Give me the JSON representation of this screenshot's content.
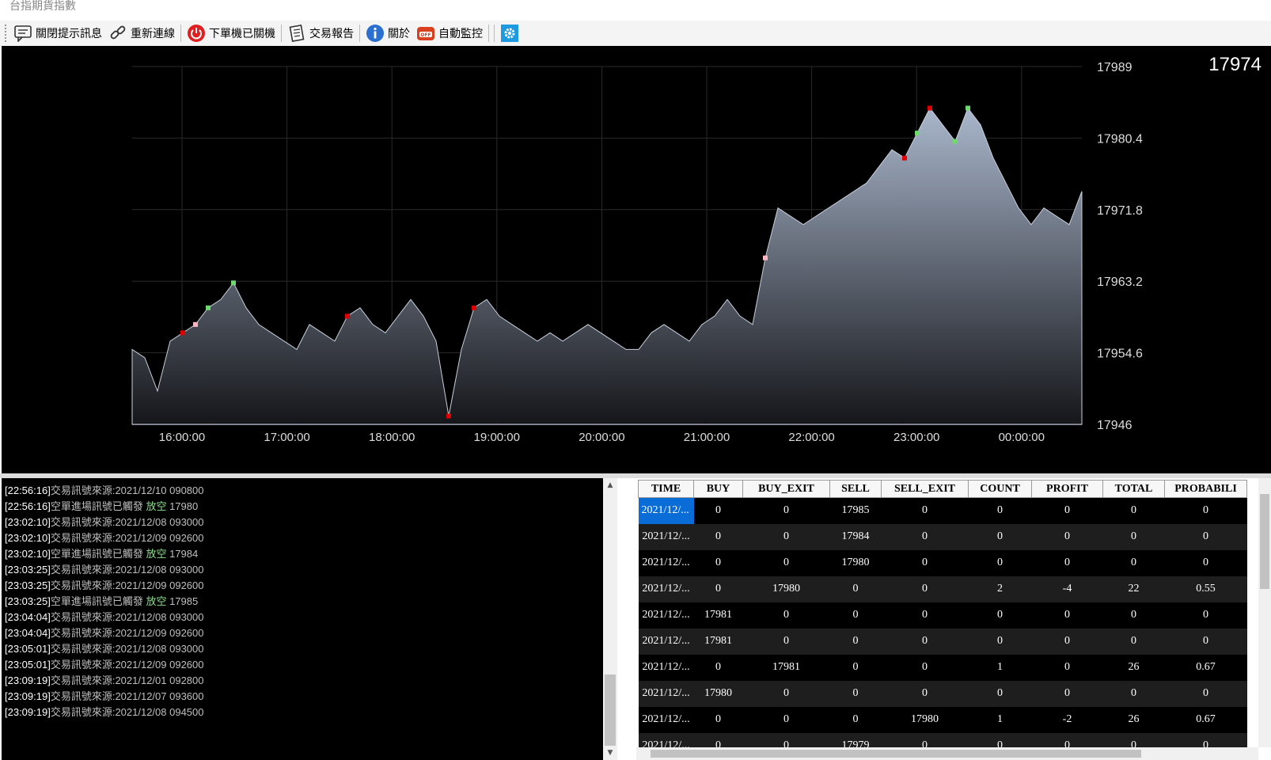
{
  "window": {
    "title": "台指期貨指數"
  },
  "toolbar": {
    "items": [
      {
        "label": "關閉提示訊息",
        "icon": "message-icon"
      },
      {
        "label": "重新連線",
        "icon": "link-icon"
      },
      {
        "label": "下單機已關機",
        "icon": "power-icon"
      },
      {
        "label": "交易報告",
        "icon": "report-icon"
      },
      {
        "label": "關於",
        "icon": "info-icon"
      },
      {
        "label": "自動監控",
        "icon": "monitor-off-icon"
      }
    ]
  },
  "current_price": "17974",
  "chart_data": {
    "type": "area",
    "x_labels": [
      "16:00:00",
      "17:00:00",
      "18:00:00",
      "19:00:00",
      "20:00:00",
      "21:00:00",
      "22:00:00",
      "23:00:00",
      "00:00:00"
    ],
    "y_labels": [
      "17989",
      "17980.4",
      "17971.8",
      "17963.2",
      "17954.6",
      "17946"
    ],
    "ylim": [
      17946,
      17989
    ],
    "series": [
      {
        "values": [
          17955,
          17954,
          17950,
          17956,
          17957,
          17958,
          17960,
          17961,
          17963,
          17960,
          17958,
          17957,
          17956,
          17955,
          17958,
          17957,
          17956,
          17959,
          17960,
          17958,
          17957,
          17959,
          17961,
          17959,
          17956,
          17947,
          17955,
          17960,
          17961,
          17959,
          17958,
          17957,
          17956,
          17957,
          17956,
          17957,
          17958,
          17957,
          17956,
          17955,
          17955,
          17957,
          17958,
          17957,
          17956,
          17958,
          17959,
          17961,
          17959,
          17958,
          17966,
          17972,
          17971,
          17970,
          17971,
          17972,
          17973,
          17974,
          17975,
          17977,
          17979,
          17978,
          17981,
          17984,
          17982,
          17980,
          17984,
          17982,
          17978,
          17975,
          17972,
          17970,
          17972,
          17971,
          17970,
          17974
        ]
      }
    ],
    "markers": {
      "buy_color": "#e00000",
      "sell_color": "#6fd86f",
      "exit_color": "#ffb6c1"
    }
  },
  "log": {
    "lines": [
      {
        "time": "[22:56:16]",
        "text": "交易訊號來源:2021/12/10 090800",
        "action": "",
        "value": ""
      },
      {
        "time": "[22:56:16]",
        "text": "空單進場訊號已觸發 ",
        "action": "放空",
        "value": " 17980"
      },
      {
        "time": "[23:02:10]",
        "text": "交易訊號來源:2021/12/08 093000",
        "action": "",
        "value": ""
      },
      {
        "time": "[23:02:10]",
        "text": "交易訊號來源:2021/12/09 092600",
        "action": "",
        "value": ""
      },
      {
        "time": "[23:02:10]",
        "text": "空單進場訊號已觸發 ",
        "action": "放空",
        "value": " 17984"
      },
      {
        "time": "[23:03:25]",
        "text": "交易訊號來源:2021/12/08 093000",
        "action": "",
        "value": ""
      },
      {
        "time": "[23:03:25]",
        "text": "交易訊號來源:2021/12/09 092600",
        "action": "",
        "value": ""
      },
      {
        "time": "[23:03:25]",
        "text": "空單進場訊號已觸發 ",
        "action": "放空",
        "value": " 17985"
      },
      {
        "time": "[23:04:04]",
        "text": "交易訊號來源:2021/12/08 093000",
        "action": "",
        "value": ""
      },
      {
        "time": "[23:04:04]",
        "text": "交易訊號來源:2021/12/09 092600",
        "action": "",
        "value": ""
      },
      {
        "time": "[23:05:01]",
        "text": "交易訊號來源:2021/12/08 093000",
        "action": "",
        "value": ""
      },
      {
        "time": "[23:05:01]",
        "text": "交易訊號來源:2021/12/09 092600",
        "action": "",
        "value": ""
      },
      {
        "time": "[23:09:19]",
        "text": "交易訊號來源:2021/12/01 092800",
        "action": "",
        "value": ""
      },
      {
        "time": "[23:09:19]",
        "text": "交易訊號來源:2021/12/07 093600",
        "action": "",
        "value": ""
      },
      {
        "time": "[23:09:19]",
        "text": "交易訊號來源:2021/12/08 094500",
        "action": "",
        "value": ""
      }
    ]
  },
  "grid": {
    "columns": [
      "TIME",
      "BUY",
      "BUY_EXIT",
      "SELL",
      "SELL_EXIT",
      "COUNT",
      "PROFIT",
      "TOTAL",
      "PROBABILI"
    ],
    "rows": [
      [
        "2021/12/...",
        "0",
        "0",
        "17985",
        "0",
        "0",
        "0",
        "0",
        "0"
      ],
      [
        "2021/12/...",
        "0",
        "0",
        "17984",
        "0",
        "0",
        "0",
        "0",
        "0"
      ],
      [
        "2021/12/...",
        "0",
        "0",
        "17980",
        "0",
        "0",
        "0",
        "0",
        "0"
      ],
      [
        "2021/12/...",
        "0",
        "17980",
        "0",
        "0",
        "2",
        "-4",
        "22",
        "0.55"
      ],
      [
        "2021/12/...",
        "17981",
        "0",
        "0",
        "0",
        "0",
        "0",
        "0",
        "0"
      ],
      [
        "2021/12/...",
        "17981",
        "0",
        "0",
        "0",
        "0",
        "0",
        "0",
        "0"
      ],
      [
        "2021/12/...",
        "0",
        "17981",
        "0",
        "0",
        "1",
        "0",
        "26",
        "0.67"
      ],
      [
        "2021/12/...",
        "17980",
        "0",
        "0",
        "0",
        "0",
        "0",
        "0",
        "0"
      ],
      [
        "2021/12/...",
        "0",
        "0",
        "0",
        "17980",
        "1",
        "-2",
        "26",
        "0.67"
      ],
      [
        "2021/12/...",
        "0",
        "0",
        "17979",
        "0",
        "0",
        "0",
        "0",
        "0"
      ]
    ]
  }
}
